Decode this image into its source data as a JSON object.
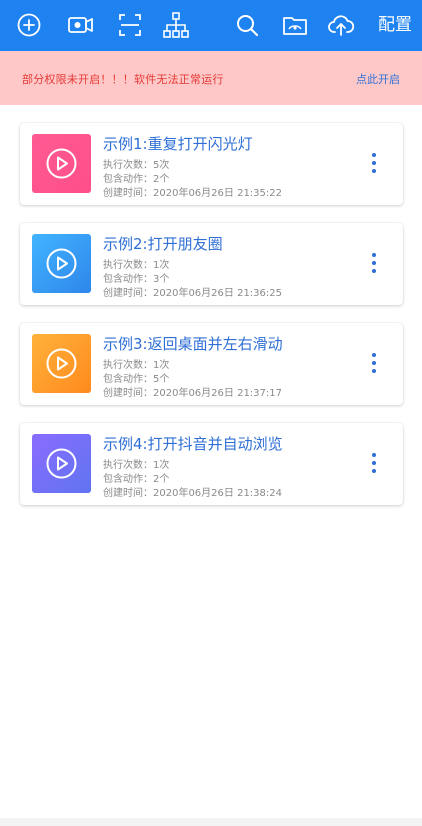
{
  "toolbar": {
    "icons": [
      "add-icon",
      "record-icon",
      "scan-icon",
      "hierarchy-icon",
      "search-icon",
      "folder-icon",
      "cloud-upload-icon"
    ],
    "config_label": "配置"
  },
  "warning": {
    "message": "部分权限未开启！！！软件无法正常运行",
    "action": "点此开启"
  },
  "items": [
    {
      "title": "示例1:重复打开闪光灯",
      "runs": "执行次数：5次",
      "actions": "包含动作：2个",
      "created": "创建时间：2020年06月26日 21:35:22",
      "colors": [
        "#ff5a93",
        "#ff4f8a"
      ]
    },
    {
      "title": "示例2:打开朋友圈",
      "runs": "执行次数：1次",
      "actions": "包含动作：3个",
      "created": "创建时间：2020年06月26日 21:36:25",
      "colors": [
        "#42b4ff",
        "#2e86ea"
      ]
    },
    {
      "title": "示例3:返回桌面并左右滑动",
      "runs": "执行次数：1次",
      "actions": "包含动作：5个",
      "created": "创建时间：2020年06月26日 21:37:17",
      "colors": [
        "#ffb23a",
        "#ff8a1e"
      ]
    },
    {
      "title": "示例4:打开抖音并自动浏览",
      "runs": "执行次数：1次",
      "actions": "包含动作：2个",
      "created": "创建时间：2020年06月26日 21:38:24",
      "colors": [
        "#8b6cff",
        "#5f74f0"
      ]
    }
  ],
  "more_icon": "more-vertical-icon"
}
